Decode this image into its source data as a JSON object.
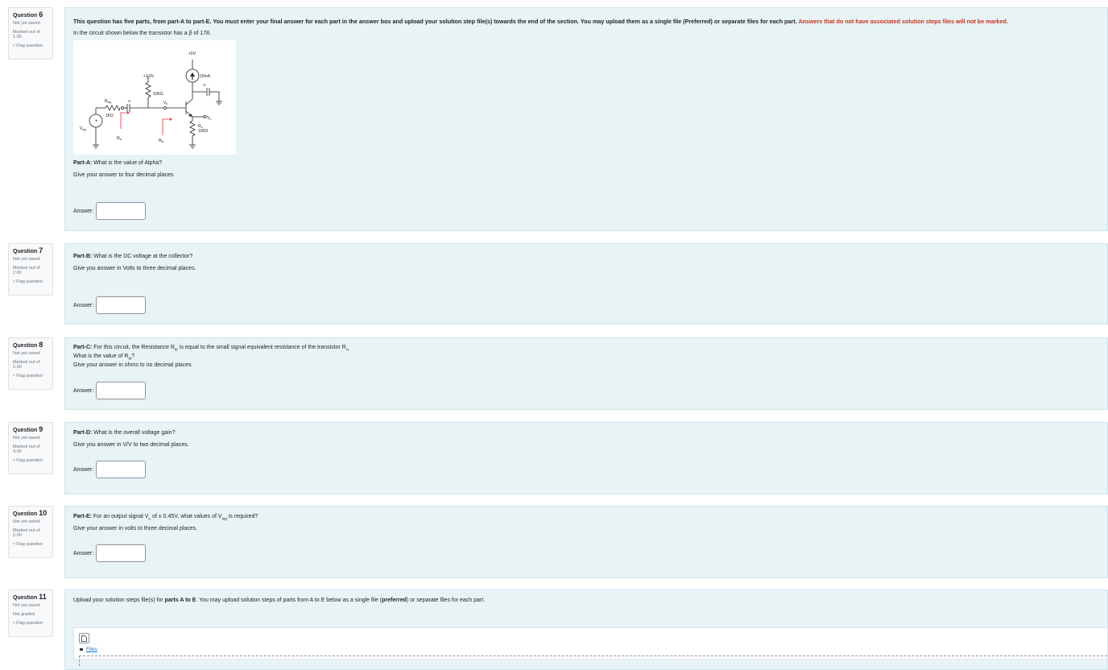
{
  "questions": [
    {
      "number": "6",
      "state": "Not yet saved",
      "mark_label": "Marked out of",
      "mark": "1.00",
      "flag": "Flag question"
    },
    {
      "number": "7",
      "state": "Not yet saved",
      "mark_label": "Marked out of",
      "mark": "2.00",
      "flag": "Flag question"
    },
    {
      "number": "8",
      "state": "Not yet saved",
      "mark_label": "Marked out of",
      "mark": "2.00",
      "flag": "Flag question"
    },
    {
      "number": "9",
      "state": "Not yet saved",
      "mark_label": "Marked out of",
      "mark": "4.00",
      "flag": "Flag question"
    },
    {
      "number": "10",
      "state": "Not yet saved",
      "mark_label": "Marked out of",
      "mark": "2.00",
      "flag": "Flag question"
    },
    {
      "number": "11",
      "state": "Not yet saved",
      "mark_label": "Not graded",
      "mark": "",
      "flag": "Flag question"
    }
  ],
  "question_word": "Question",
  "intro": "This question has five parts, from part-A to part-E. You must enter your final answer for each part in the answer box and upload your solution step file(s) towards the end of the section. You may upload them as a single file (Preferred) or separate files for each part.",
  "warning": "Answers that do not have associated solution steps files will not be marked.",
  "circuit_intro": "In the circuit shown below the transistor has a β of 178.",
  "circuit": {
    "vplus": "+5V",
    "vb": "+1.5V",
    "current": "10mA",
    "rb": "10KΩ",
    "vb_label": "V",
    "rsig": "R",
    "rsig_val": "1KΩ",
    "cap_inf": "∞",
    "cap_inf2": "∞",
    "vsig": "V",
    "vo": "V",
    "re": "R",
    "re_val": "100Ω",
    "rin": "R",
    "rib": "R"
  },
  "answer_label": "Answer:",
  "partA": {
    "label": "Part-A:",
    "q": "What is the value of Alpha?",
    "hint": "Give your answer to four decimal places"
  },
  "partB": {
    "label": "Part-B:",
    "q": "What is the DC voltage at the collector?",
    "hint": "Give you answer in Volts to three decimal places."
  },
  "partC": {
    "label": "Part-C:",
    "q1": "For this circuit, the Resistance R",
    "q1b": " is equal to the  small signal equivalent resistance of the transistor R",
    "q2a": "What is the value of R",
    "q2b": "?",
    "hint": "Give your answer in ohms to no decimal places"
  },
  "partD": {
    "label": "Part-D:",
    "q": "What is the overall voltage gain?",
    "hint": "Give you answer in V/V to two decimal places."
  },
  "partE": {
    "label": "Part-E:",
    "q1": "For an output signal V",
    "q2": " of ± 0.45V, what values of V",
    "q3": " is required?",
    "hint": "Give your answer in volts to three decimal places."
  },
  "upload": {
    "pre": "Upload your solution steps file(s) for ",
    "bold1": "parts A to E",
    "mid": ". You may upload solution steps of parts from A to E below as a single file (",
    "bold2": "preferred",
    "post": ") or separate files for each part.",
    "files": "Files"
  }
}
